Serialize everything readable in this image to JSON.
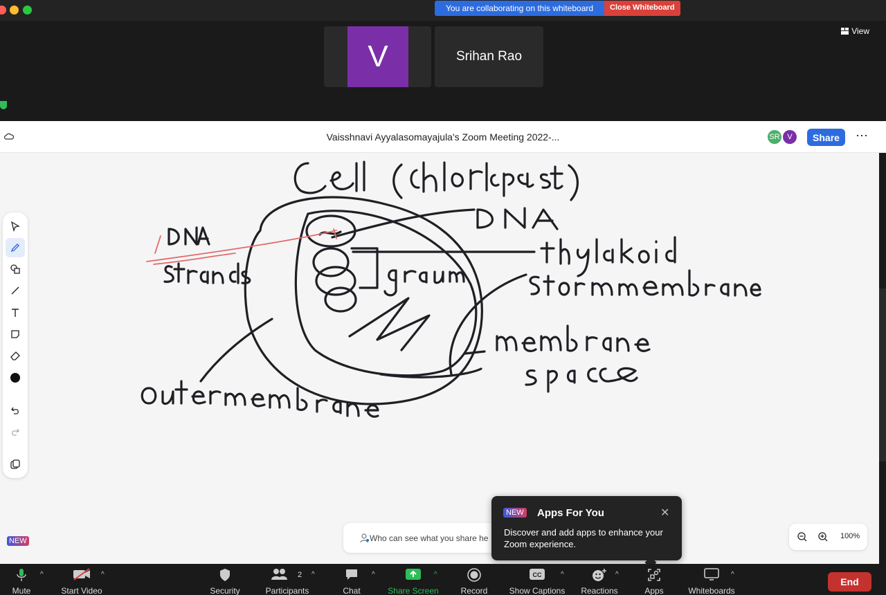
{
  "collab_banner": {
    "message": "You are collaborating on this whiteboard",
    "close_label": "Close Whiteboard"
  },
  "participants_strip": {
    "tiles": [
      {
        "initial": "V",
        "color": "#7a2fa8"
      },
      {
        "name": "Srihan Rao"
      }
    ],
    "view_label": "View"
  },
  "whiteboard": {
    "title": "Vaisshnavi Ayyalasomayajula's Zoom Meeting 2022-...",
    "avatars": [
      {
        "initials": "SR",
        "color": "#4caf6a"
      },
      {
        "initials": "V",
        "color": "#7a2fa8"
      }
    ],
    "share_label": "Share",
    "more_label": "⋯",
    "drawing_text": {
      "title": "Cell (chlorlopast)",
      "dna_right": "DNA",
      "thylakoid": "thylakoid",
      "stroma_membrane": "Stor mmembrane",
      "membrane_space_1": "membrane",
      "membrane_space_2": "spaCe",
      "granum": "granum",
      "dna_left": "DNA",
      "strands": "strands",
      "outer_membrane": "outermembrane"
    },
    "tools": [
      "select-icon",
      "pen-icon",
      "shapes-icon",
      "line-icon",
      "text-icon",
      "sticky-note-icon",
      "eraser-icon",
      "color-icon",
      "undo-icon",
      "redo-icon",
      "layers-icon"
    ],
    "new_badge": "NEW",
    "who_can_see": "Who can see what you share he",
    "zoom_level": "100%"
  },
  "apps_popup": {
    "badge": "NEW",
    "title": "Apps For You",
    "body": "Discover and add apps to enhance your Zoom experience."
  },
  "toolbar": {
    "mute": "Mute",
    "start_video": "Start Video",
    "security": "Security",
    "participants": "Participants",
    "participants_count": "2",
    "chat": "Chat",
    "share_screen": "Share Screen",
    "record": "Record",
    "captions": "Show Captions",
    "reactions": "Reactions",
    "apps": "Apps",
    "whiteboards": "Whiteboards",
    "end": "End"
  }
}
